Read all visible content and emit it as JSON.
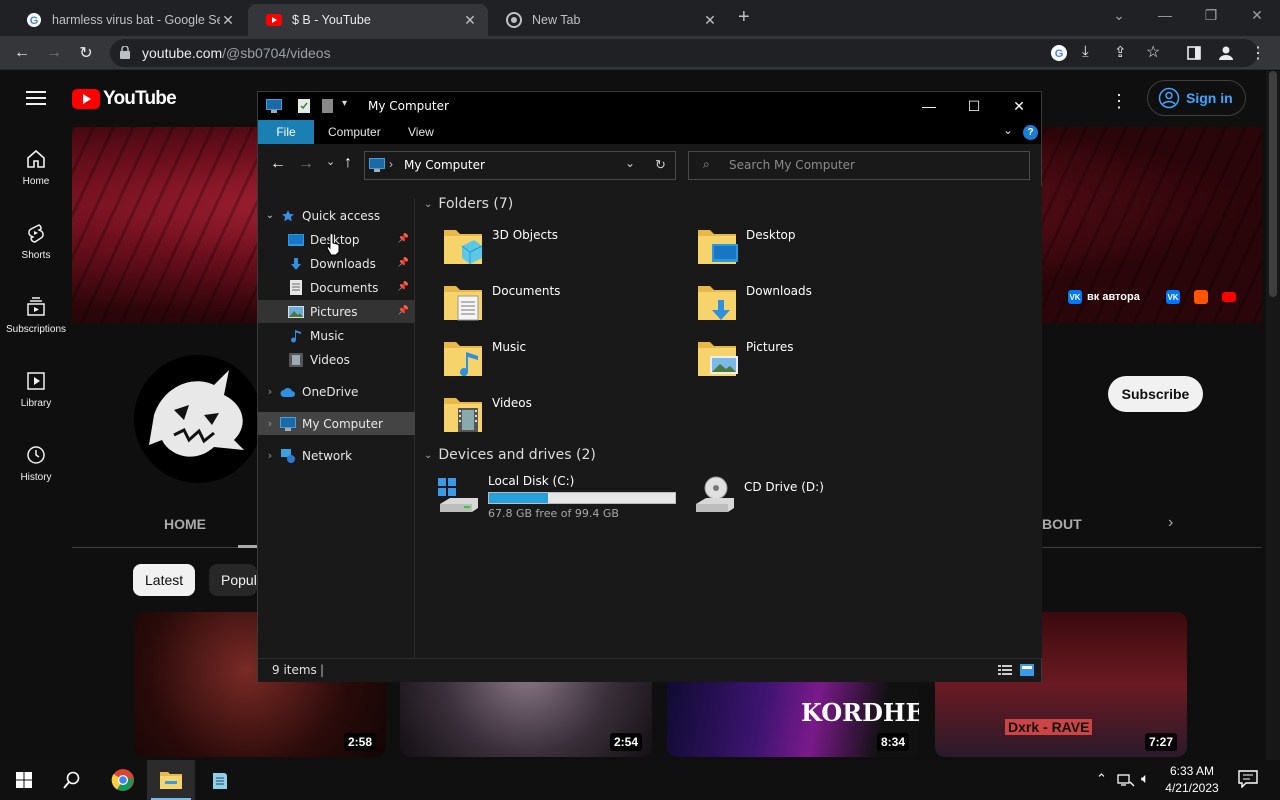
{
  "browser": {
    "tabs": [
      {
        "title": "harmless virus bat - Google Sear",
        "active": false,
        "favicon": "google-icon"
      },
      {
        "title": "$ B - YouTube",
        "active": true,
        "favicon": "youtube-icon"
      },
      {
        "title": "New Tab",
        "active": false,
        "favicon": "chrome-icon"
      }
    ],
    "url_host": "youtube.com",
    "url_path": "/@sb0704/videos"
  },
  "youtube": {
    "logo": "YouTube",
    "sidebar": [
      {
        "label": "Home",
        "icon": "home-icon"
      },
      {
        "label": "Shorts",
        "icon": "shorts-icon"
      },
      {
        "label": "Subscriptions",
        "icon": "subscriptions-icon"
      },
      {
        "label": "Library",
        "icon": "library-icon"
      },
      {
        "label": "History",
        "icon": "history-icon"
      }
    ],
    "sign_in": "Sign in",
    "banner_link": "вк автора",
    "subscribe": "Subscribe",
    "tab_home": "HOME",
    "tab_about": "BOUT",
    "chips": [
      "Latest",
      "Popul"
    ],
    "videos": [
      {
        "duration": "2:58",
        "caption": ""
      },
      {
        "duration": "2:54",
        "caption": ""
      },
      {
        "duration": "8:34",
        "caption": "KORDHELL"
      },
      {
        "duration": "7:27",
        "caption": "Dxrk - RAVE"
      }
    ]
  },
  "explorer": {
    "title": "My Computer",
    "ribbon": [
      "File",
      "Computer",
      "View"
    ],
    "address": "My Computer",
    "search_placeholder": "Search My Computer",
    "nav": {
      "quick_access": "Quick access",
      "items": [
        "Desktop",
        "Downloads",
        "Documents",
        "Pictures",
        "Music",
        "Videos"
      ],
      "onedrive": "OneDrive",
      "my_computer": "My Computer",
      "network": "Network"
    },
    "folders_header": "Folders (7)",
    "folders": [
      "3D Objects",
      "Desktop",
      "Documents",
      "Downloads",
      "Music",
      "Pictures",
      "Videos"
    ],
    "drives_header": "Devices and drives (2)",
    "drives": [
      {
        "name": "Local Disk (C:)",
        "free": "67.8 GB free of 99.4 GB",
        "used_fraction": 0.318
      },
      {
        "name": "CD Drive (D:)"
      }
    ],
    "status": "9 items"
  },
  "taskbar": {
    "time": "6:33 AM",
    "date": "4/21/2023"
  }
}
